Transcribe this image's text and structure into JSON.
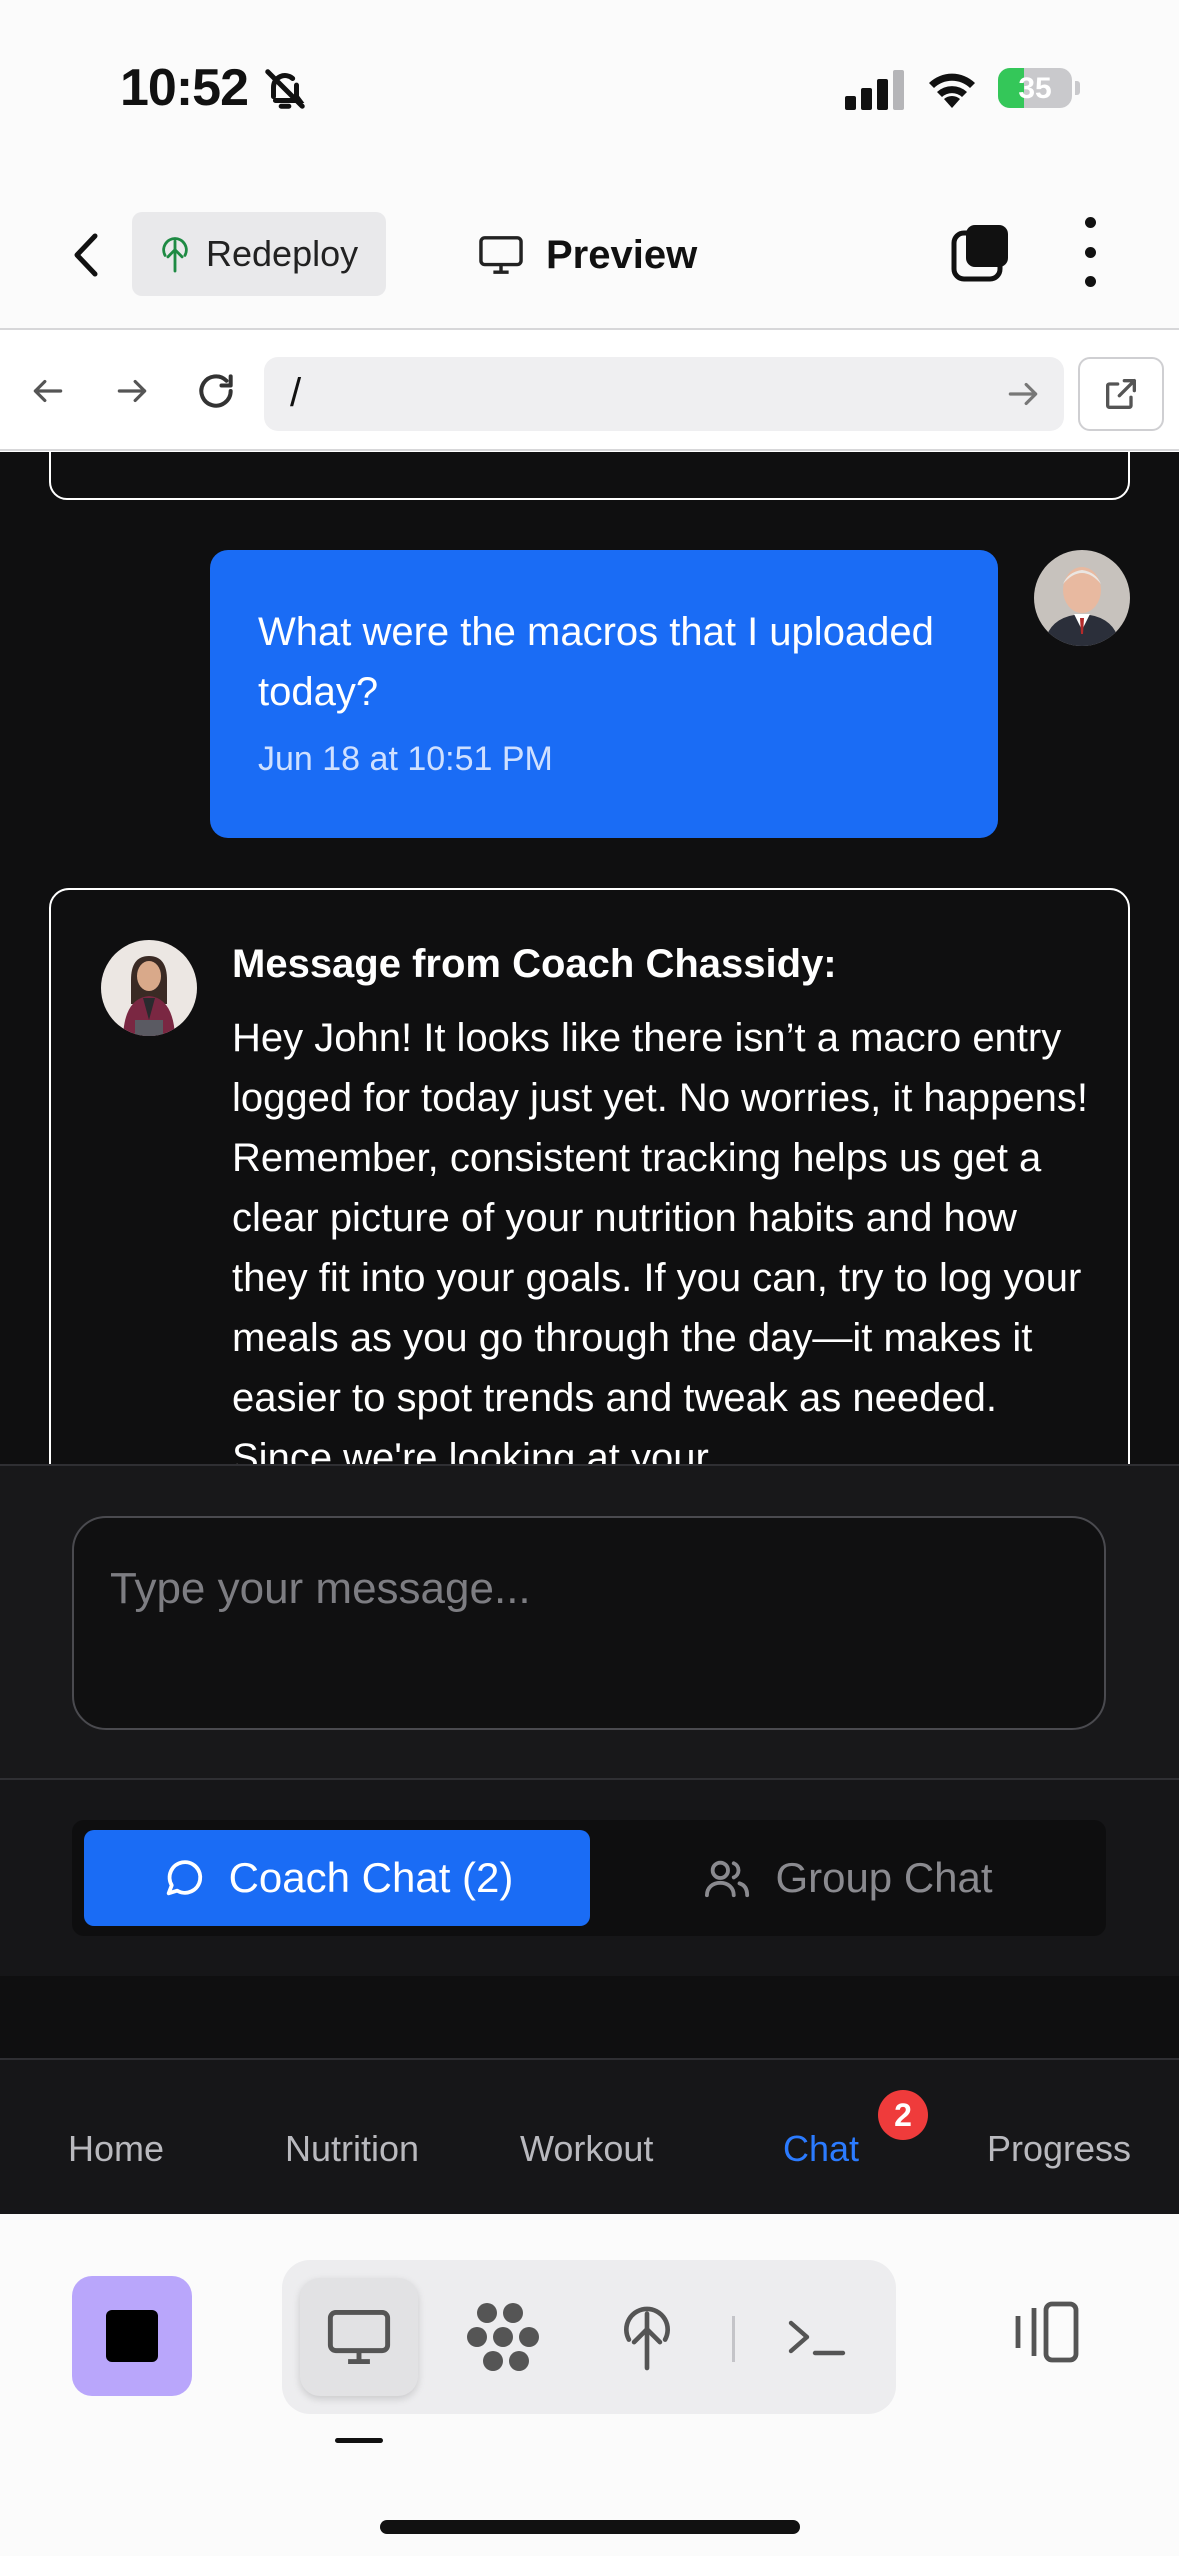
{
  "status_bar": {
    "time": "10:52",
    "battery": "35",
    "battery_level_pct": 35
  },
  "header": {
    "redeploy_label": "Redeploy",
    "preview_label": "Preview"
  },
  "url_bar": {
    "path": "/"
  },
  "chat": {
    "user_message": {
      "text": "What were the macros that I uploaded today?",
      "timestamp": "Jun 18 at 10:51 PM"
    },
    "coach_message": {
      "title": "Message from Coach Chassidy:",
      "text": "Hey John! It looks like there isn’t a macro entry logged for today just yet. No worries, it happens! Remember, consistent tracking helps us get a clear picture of your nutrition habits and how they fit into your goals. If you can, try to log your meals as you go through the day—it makes it easier to spot trends and tweak as needed. Since we're looking at your"
    }
  },
  "composer": {
    "placeholder": "Type your message..."
  },
  "chat_toggle": {
    "coach_label": "Coach Chat (2)",
    "group_label": "Group Chat"
  },
  "bottom_nav": {
    "items": [
      {
        "label": "Home"
      },
      {
        "label": "Nutrition"
      },
      {
        "label": "Workout"
      },
      {
        "label": "Chat"
      },
      {
        "label": "Progress"
      }
    ],
    "active": "Chat",
    "chat_badge": "2"
  },
  "colors": {
    "accent": "#1a6cf5",
    "badge": "#ef3b3b",
    "stop_button": "#b9a6fb"
  }
}
